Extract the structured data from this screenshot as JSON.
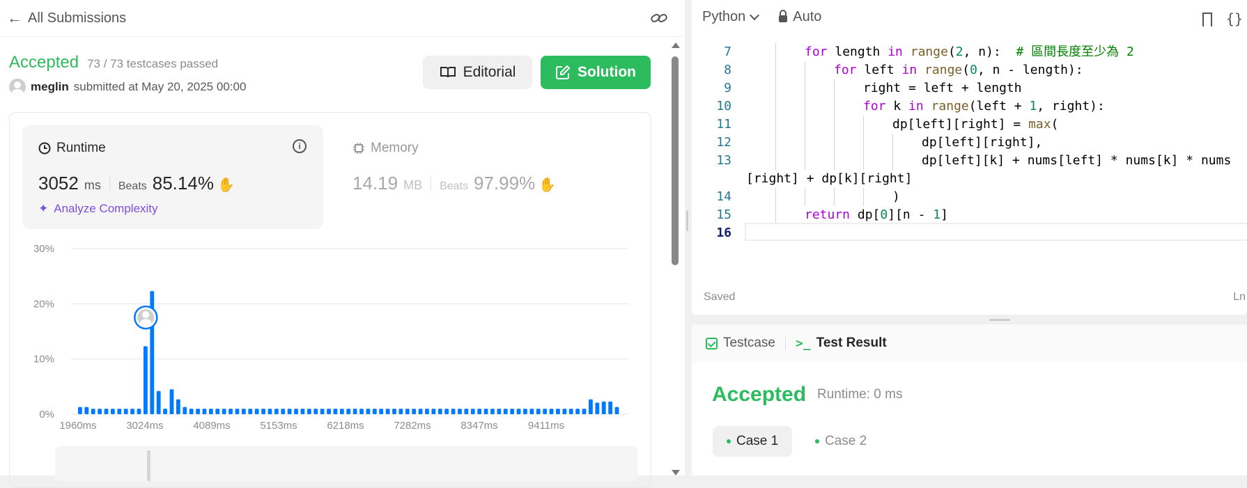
{
  "header": {
    "back_title": "All Submissions"
  },
  "submission": {
    "status": "Accepted",
    "testcases": "73 / 73 testcases passed",
    "user": "meglin",
    "submitted_text": "submitted at May 20, 2025 00:00",
    "editorial_label": "Editorial",
    "solution_label": "Solution"
  },
  "runtime": {
    "label": "Runtime",
    "value": "3052",
    "unit": "ms",
    "beats_label": "Beats",
    "beats_pct": "85.14%",
    "analyze_label": "Analyze Complexity"
  },
  "memory": {
    "label": "Memory",
    "value": "14.19",
    "unit": "MB",
    "beats_label": "Beats",
    "beats_pct": "97.99%"
  },
  "colors": {
    "accent_green": "#2cbb5d",
    "bar_blue": "#007aff",
    "purple": "#7b4fd9"
  },
  "chart_data": {
    "type": "bar",
    "x_tick_labels": [
      "1960ms",
      "3024ms",
      "4089ms",
      "5153ms",
      "6218ms",
      "7282ms",
      "8347ms",
      "9411ms"
    ],
    "y_tick_labels": [
      "0%",
      "10%",
      "20%",
      "30%"
    ],
    "ylim": [
      0,
      30
    ],
    "grid": true,
    "highlight_index": 11,
    "values": [
      1.3,
      1.3,
      1,
      1,
      1,
      1,
      1,
      1,
      1,
      1,
      12.3,
      22.3,
      4.2,
      1,
      4.5,
      2.7,
      1.3,
      1,
      1,
      1,
      1,
      1,
      1,
      1,
      1,
      1,
      1,
      1,
      1,
      1,
      1,
      1,
      1,
      1,
      1,
      1,
      1,
      1,
      1,
      1,
      1,
      1,
      1,
      1,
      1,
      1,
      1,
      1,
      1,
      1,
      1,
      1,
      1,
      1,
      1,
      1,
      1,
      1,
      1,
      1,
      1,
      1,
      1,
      1,
      1,
      1,
      1,
      1,
      1,
      1,
      1,
      1,
      1,
      1,
      1,
      1,
      1,
      1,
      2.7,
      2.1,
      2.3,
      2.3,
      1.3
    ]
  },
  "editor": {
    "language": "Python",
    "mode": "Auto",
    "lines": [
      {
        "n": "7",
        "indent": 2,
        "code": "for length in range(2, n):  # 區間長度至少為 2"
      },
      {
        "n": "8",
        "indent": 3,
        "code": "for left in range(0, n - length):"
      },
      {
        "n": "9",
        "indent": 4,
        "code": "right = left + length"
      },
      {
        "n": "10",
        "indent": 4,
        "code": "for k in range(left + 1, right):"
      },
      {
        "n": "11",
        "indent": 5,
        "code": "dp[left][right] = max("
      },
      {
        "n": "12",
        "indent": 6,
        "code": "dp[left][right],"
      },
      {
        "n": "13",
        "indent": 6,
        "code": "dp[left][k] + nums[left] * nums[k] * nums"
      },
      {
        "n": "",
        "indent": 0,
        "code": "[right] + dp[k][right]"
      },
      {
        "n": "14",
        "indent": 5,
        "code": ")"
      },
      {
        "n": "15",
        "indent": 2,
        "code": "return dp[0][n - 1]"
      },
      {
        "n": "16",
        "indent": 0,
        "code": ""
      }
    ],
    "saved_label": "Saved",
    "ln_label": "Ln"
  },
  "console": {
    "tab_testcase": "Testcase",
    "tab_result": "Test Result",
    "result_status": "Accepted",
    "result_runtime": "Runtime: 0 ms",
    "cases": [
      "Case 1",
      "Case 2"
    ]
  }
}
